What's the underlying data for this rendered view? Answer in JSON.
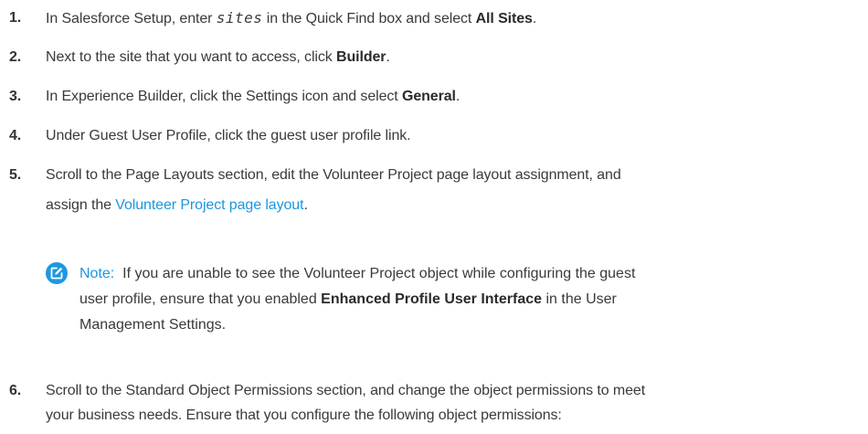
{
  "steps": [
    {
      "number": "1.",
      "t1": "In Salesforce Setup, enter ",
      "code": "sites",
      "t2": " in the Quick Find box and select ",
      "bold": "All Sites",
      "t3": "."
    },
    {
      "number": "2.",
      "t1": "Next to the site that you want to access, click ",
      "bold": "Builder",
      "t2": "."
    },
    {
      "number": "3.",
      "t1": "In Experience Builder, click the Settings icon and select ",
      "bold": "General",
      "t2": "."
    },
    {
      "number": "4.",
      "t1": "Under Guest User Profile, click the guest user profile link."
    },
    {
      "number": "5.",
      "line1": "Scroll to the Page Layouts section, edit the Volunteer Project page layout assignment, and",
      "line2_pre": "assign the ",
      "link": "Volunteer Project page layout",
      "line2_post": "."
    },
    {
      "number": "6.",
      "line1": "Scroll to the Standard Object Permissions section, and change the object permissions to meet",
      "line2": "your business needs. Ensure that you configure the following object permissions:"
    }
  ],
  "note": {
    "icon": "edit-note-icon",
    "label": "Note:",
    "line1": "If you are unable to see the Volunteer Project object while configuring the guest",
    "line2_pre": "user profile, ensure that you enabled ",
    "bold": "Enhanced Profile User Interface",
    "line2_post": " in the User",
    "line3": "Management Settings.",
    "icon_color": "#1d98e0",
    "label_color": "#1b96e0"
  }
}
